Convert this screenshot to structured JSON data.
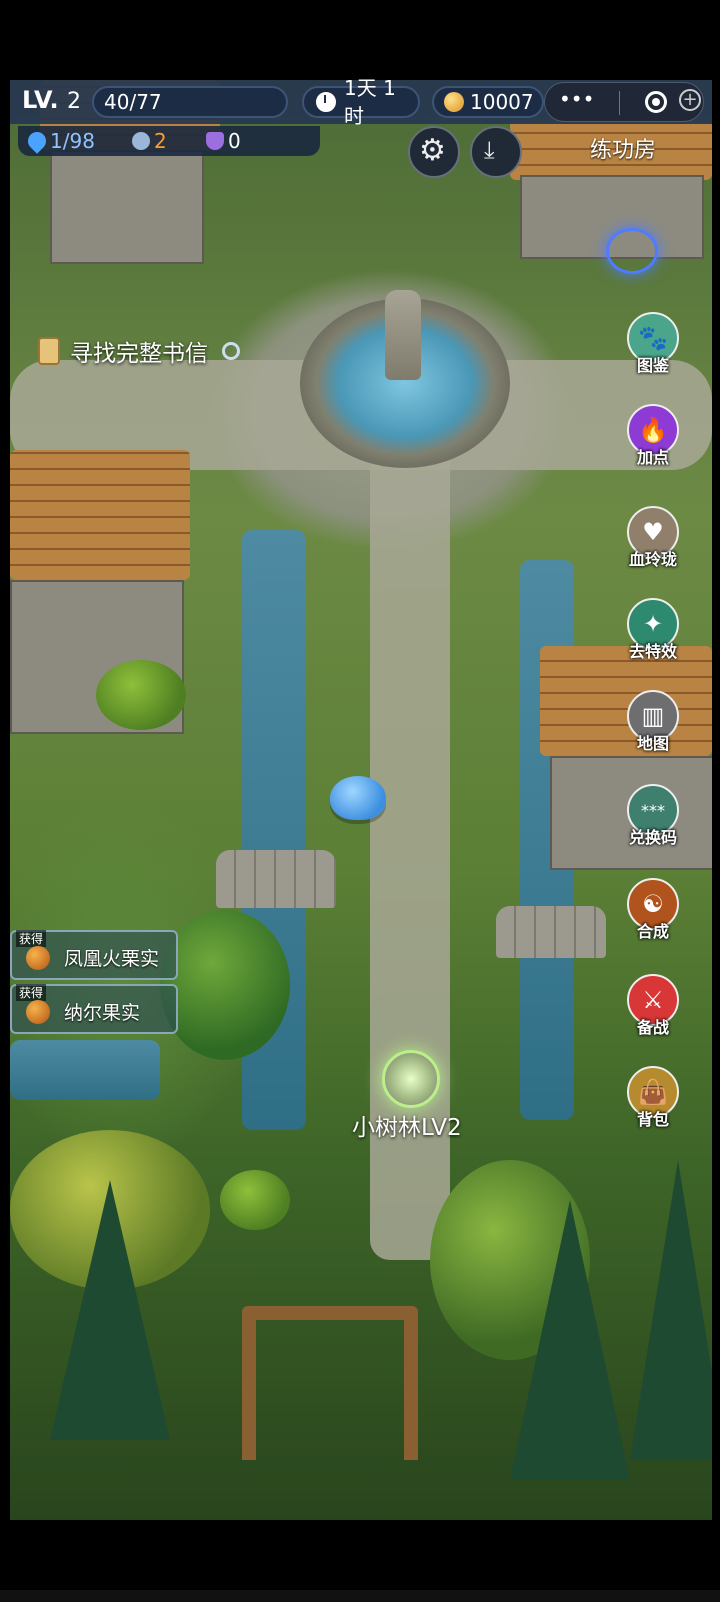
{
  "hud": {
    "level_prefix": "LV.",
    "level": "2",
    "xp": "40/77",
    "time": "1天 1时",
    "coins": "10007",
    "capsule_dots": "•••"
  },
  "stats": [
    {
      "value": "1/98",
      "color": "#4aa3ff"
    },
    {
      "value": "2",
      "color": "#ff9b2f"
    },
    {
      "value": "0",
      "color": "#ffffff"
    }
  ],
  "colors": {
    "hud_bar": "#27384f",
    "panel": "#1d2c45"
  },
  "room_label": "练功房",
  "quest": {
    "text": "寻找完整书信"
  },
  "side_buttons": [
    {
      "name": "图鉴",
      "icon": "paw-icon",
      "color": "#4aa58a"
    },
    {
      "name": "加点",
      "icon": "flame-icon",
      "color": "#8e3bd6"
    },
    {
      "name": "血玲珑",
      "icon": "heart-icon",
      "color": "#8f7f6b"
    },
    {
      "name": "去特效",
      "icon": "sparkle-icon",
      "color": "#2e8a6e"
    },
    {
      "name": "地图",
      "icon": "map-icon",
      "color": "#6e6e70"
    },
    {
      "name": "兑换码",
      "icon": "code-icon",
      "color": "#3f7f6e"
    },
    {
      "name": "合成",
      "icon": "yin-yang-icon",
      "color": "#b0531d"
    },
    {
      "name": "备战",
      "icon": "crossed-swords-icon",
      "color": "#d93737"
    },
    {
      "name": "背包",
      "icon": "bag-icon",
      "color": "#b58b2e"
    }
  ],
  "loot": [
    {
      "tag": "获得",
      "name": "凤凰火栗实"
    },
    {
      "tag": "获得",
      "name": "纳尔果实"
    }
  ],
  "area_label": "小树林LV2"
}
